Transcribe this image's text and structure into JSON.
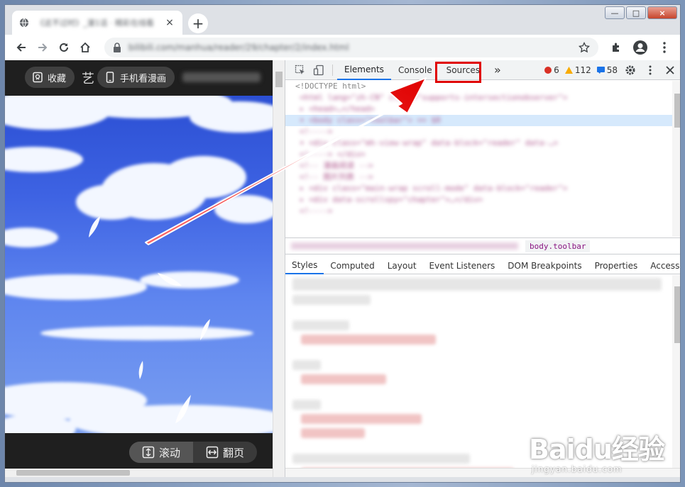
{
  "browser": {
    "tab_title": "《这不过时》_漫1话 · 精彩在线看",
    "tab_close": "×",
    "new_tab": "+",
    "url": "bilibili.com/manhua/reader/29/chapter/2/index.html",
    "window_controls": {
      "minimize": "—",
      "maximize": "□",
      "close": "×"
    }
  },
  "page": {
    "favorite_label": "收藏",
    "mobile_label": "手机看漫画",
    "title_fragment": "艺",
    "mode_scroll_label": "滚动",
    "mode_page_label": "翻页"
  },
  "devtools": {
    "tabs": [
      "Elements",
      "Console",
      "Sources"
    ],
    "more_tabs": "»",
    "errors": "6",
    "warnings": "112",
    "messages": "58",
    "doctype_line": "<!DOCTYPE html>",
    "breadcrumb_current": "body.toolbar",
    "styles_tabs": [
      "Styles",
      "Computed",
      "Layout",
      "Event Listeners",
      "DOM Breakpoints",
      "Properties",
      "Accessibility"
    ]
  },
  "watermark": {
    "brand": "Baidu经验",
    "domain": "jingyan.baidu.com"
  },
  "colors": {
    "highlight_box": "#e00000",
    "arrow": "#e00000",
    "devtools_active_tab": "#1a73e8"
  }
}
